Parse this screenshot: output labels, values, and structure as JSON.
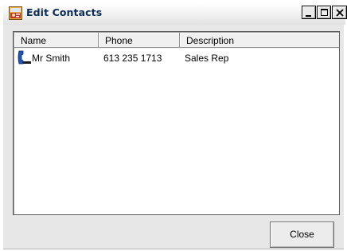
{
  "window": {
    "title": "Edit Contacts",
    "icon": "edit-contacts-app-icon",
    "caption_buttons": [
      "minimize-icon",
      "maximize-icon",
      "close-icon"
    ]
  },
  "list": {
    "columns": [
      "Name",
      "Phone",
      "Description"
    ],
    "rows": [
      {
        "icon": "phone-handset-icon",
        "name": "Mr Smith",
        "phone": "613 235 1713",
        "description": "Sales Rep"
      }
    ]
  },
  "footer": {
    "close_label": "Close"
  },
  "colors": {
    "title_text": "#0b2d57",
    "client_background": "#e7e7e7"
  }
}
